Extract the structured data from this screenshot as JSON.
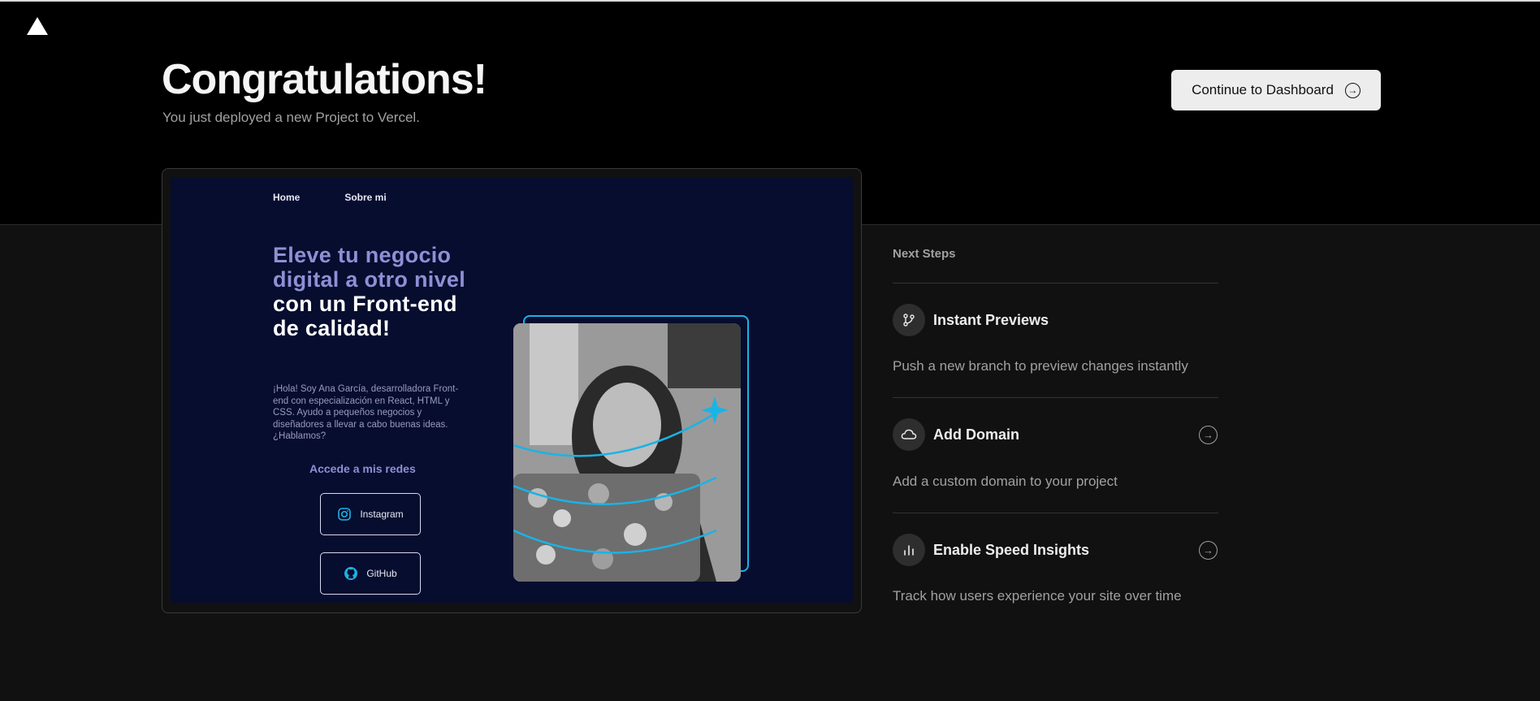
{
  "header": {
    "title": "Congratulations!",
    "subtitle": "You just deployed a new Project to Vercel.",
    "dashboard_button": "Continue to Dashboard",
    "logo_icon": "vercel-triangle-icon"
  },
  "preview": {
    "nav": [
      "Home",
      "Sobre mi"
    ],
    "hero_accent": "Eleve tu negocio digital a otro nivel",
    "hero_rest": "con un Front-end de calidad!",
    "description": "¡Hola! Soy Ana García, desarrolladora Front-end con especialización en React, HTML y CSS. Ayudo a pequeños negocios y diseñadores a llevar a cabo buenas ideas. ¿Hablamos?",
    "socials_title": "Accede a mis redes",
    "socials": [
      {
        "label": "Instagram",
        "icon": "instagram-icon"
      },
      {
        "label": "GitHub",
        "icon": "github-icon"
      }
    ],
    "accent_color": "#1ab3e6"
  },
  "next_steps": {
    "title": "Next Steps",
    "items": [
      {
        "title": "Instant Previews",
        "description": "Push a new branch to preview changes instantly",
        "icon": "git-branch-icon"
      },
      {
        "title": "Add Domain",
        "description": "Add a custom domain to your project",
        "icon": "cloud-icon"
      },
      {
        "title": "Enable Speed Insights",
        "description": "Track how users experience your site over time",
        "icon": "bar-chart-icon"
      }
    ]
  }
}
